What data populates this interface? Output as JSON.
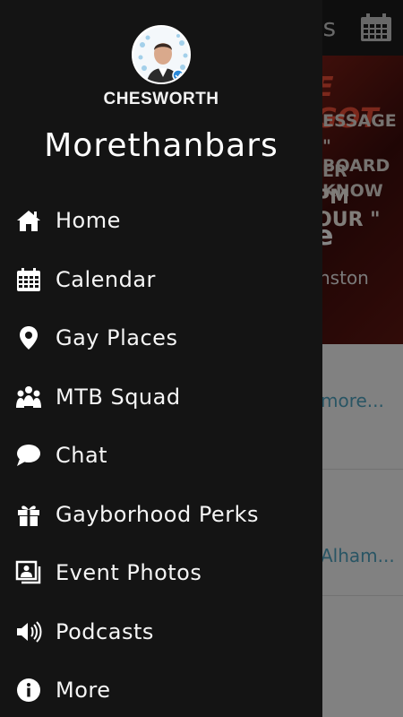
{
  "background": {
    "title_fragment": "rs",
    "banner_lines": [
      "E GOT",
      "ESSAGE",
      "\" BOARD",
      "ER KNOW",
      "PM   OUR \"",
      "e",
      "nston"
    ],
    "link1": "more...",
    "link2": "Alham..."
  },
  "drawer": {
    "username": "CHESWORTH",
    "app_name": "Morethanbars",
    "items": [
      {
        "label": "Home",
        "icon": "home-icon"
      },
      {
        "label": "Calendar",
        "icon": "calendar-icon"
      },
      {
        "label": "Gay Places",
        "icon": "map-pin-icon"
      },
      {
        "label": "MTB Squad",
        "icon": "group-icon"
      },
      {
        "label": "Chat",
        "icon": "chat-bubble-icon"
      },
      {
        "label": "Gayborhood Perks",
        "icon": "gift-icon"
      },
      {
        "label": "Event Photos",
        "icon": "photos-icon"
      },
      {
        "label": "Podcasts",
        "icon": "speaker-icon"
      },
      {
        "label": "More",
        "icon": "info-icon"
      }
    ]
  },
  "colors": {
    "drawer_bg": "#141414",
    "text": "#f5f5f5",
    "link": "#4c9bb7",
    "banner_red": "#8d241a"
  }
}
